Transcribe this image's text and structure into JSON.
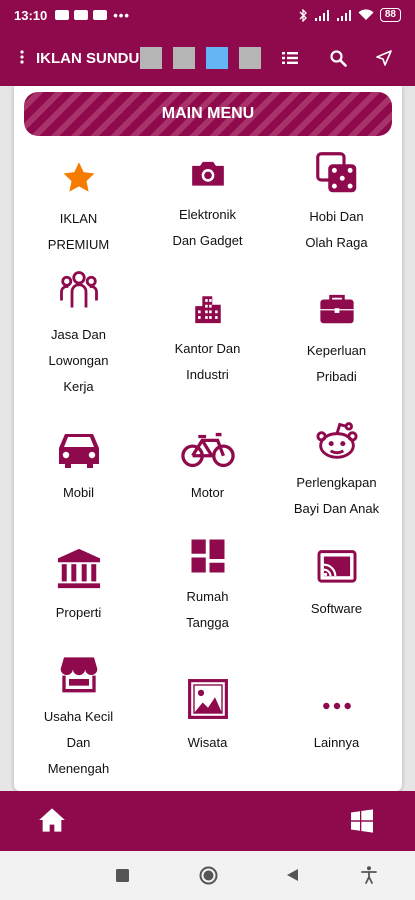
{
  "status_bar": {
    "time": "13:10",
    "more": "•••",
    "battery": "88"
  },
  "app_bar": {
    "title": "IKLAN SUNDUL",
    "swatch_colors": [
      "#b5b5b5",
      "#b5b5b5",
      "#64b5f6",
      "#b5b5b5"
    ],
    "icons": [
      "more-vert-icon",
      "list-icon",
      "search-icon",
      "navigation-icon"
    ]
  },
  "main_menu": {
    "title": "MAIN MENU",
    "items": [
      {
        "icon": "star-icon",
        "label": "IKLAN PREMIUM",
        "lines": [
          "IKLAN",
          "PREMIUM"
        ]
      },
      {
        "icon": "camera-icon",
        "label": "Elektronik Dan Gadget",
        "lines": [
          "Elektronik",
          "Dan Gadget"
        ]
      },
      {
        "icon": "dice-icon",
        "label": "Hobi Dan Olah Raga",
        "lines": [
          "Hobi Dan",
          "Olah Raga"
        ]
      },
      {
        "icon": "users-icon",
        "label": "Jasa Dan Lowongan Kerja",
        "lines": [
          "Jasa Dan",
          "Lowongan",
          "Kerja"
        ]
      },
      {
        "icon": "building-icon",
        "label": "Kantor Dan Industri",
        "lines": [
          "Kantor Dan",
          "Industri"
        ]
      },
      {
        "icon": "briefcase-icon",
        "label": "Keperluan Pribadi",
        "lines": [
          "Keperluan",
          "Pribadi"
        ]
      },
      {
        "icon": "car-icon",
        "label": "Mobil",
        "lines": [
          "Mobil"
        ]
      },
      {
        "icon": "bicycle-icon",
        "label": "Motor",
        "lines": [
          "Motor"
        ]
      },
      {
        "icon": "baby-icon",
        "label": "Perlengkapan Bayi Dan Anak",
        "lines": [
          "Perlengkapan",
          "Bayi Dan Anak"
        ]
      },
      {
        "icon": "bank-icon",
        "label": "Properti",
        "lines": [
          "Properti"
        ]
      },
      {
        "icon": "grid-icon",
        "label": "Rumah Tangga",
        "lines": [
          "Rumah",
          "Tangga"
        ]
      },
      {
        "icon": "cast-icon",
        "label": "Software",
        "lines": [
          "Software"
        ]
      },
      {
        "icon": "store-icon",
        "label": "Usaha Kecil Dan Menengah",
        "lines": [
          "Usaha Kecil",
          "Dan",
          "Menengah"
        ]
      },
      {
        "icon": "image-icon",
        "label": "Wisata",
        "lines": [
          "Wisata"
        ]
      },
      {
        "icon": "more-horiz-icon",
        "label": "Lainnya",
        "lines": [
          "Lainnya"
        ]
      }
    ]
  },
  "bottom_bar": {
    "left_icon": "home-icon",
    "right_icon": "windows-icon"
  },
  "system_nav": {
    "icons": [
      "recents-icon",
      "home-circle-icon",
      "back-icon",
      "accessibility-icon"
    ]
  },
  "colors": {
    "brand": "#8e0a4c",
    "star": "#f57c00"
  }
}
